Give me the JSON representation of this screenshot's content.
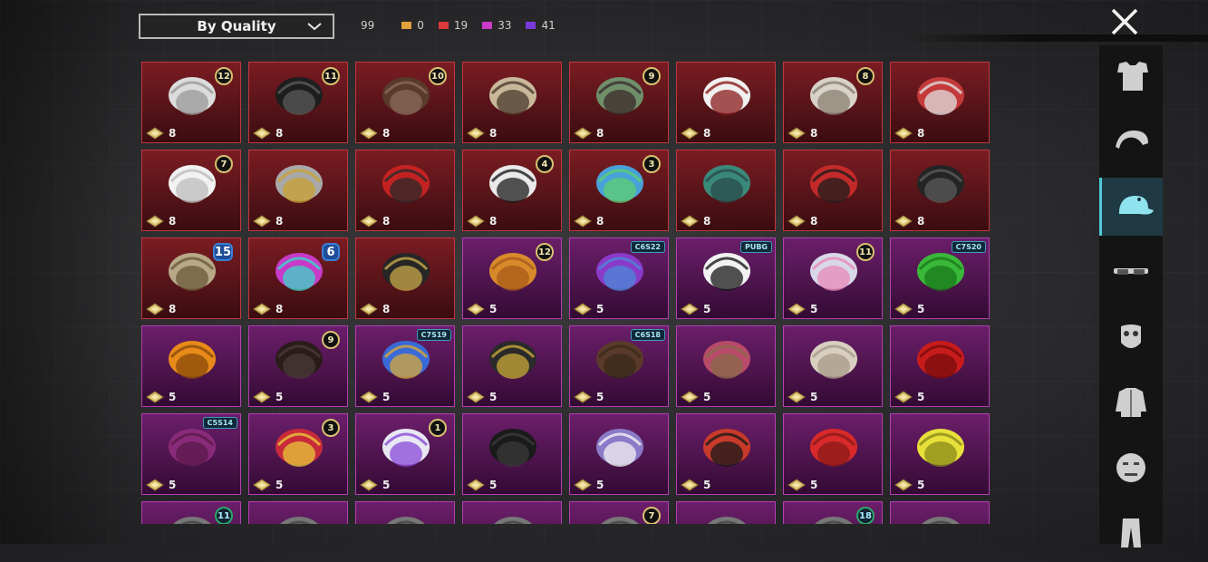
{
  "sort": {
    "label": "By Quality"
  },
  "counts": {
    "total": "99",
    "items": [
      {
        "color": "#e0a23a",
        "value": "0"
      },
      {
        "color": "#d93a3a",
        "value": "19"
      },
      {
        "color": "#c93ac8",
        "value": "33"
      },
      {
        "color": "#7a3ad9",
        "value": "41"
      }
    ]
  },
  "grid": {
    "items": [
      {
        "quality": "red",
        "badge": "12",
        "points": "8",
        "icon": "white-hair-icon"
      },
      {
        "quality": "red",
        "badge": "11",
        "points": "8",
        "icon": "black-cap-icon"
      },
      {
        "quality": "red",
        "badge": "10",
        "points": "8",
        "icon": "brown-hair-icon"
      },
      {
        "quality": "red",
        "badge": "",
        "points": "8",
        "icon": "bone-helmet-icon"
      },
      {
        "quality": "red",
        "badge": "9",
        "points": "8",
        "icon": "zombie-head-icon"
      },
      {
        "quality": "red",
        "badge": "",
        "points": "8",
        "icon": "cowboy-hat-icon"
      },
      {
        "quality": "red",
        "badge": "8",
        "points": "8",
        "icon": "silver-hair-icon"
      },
      {
        "quality": "red",
        "badge": "",
        "points": "8",
        "icon": "demon-mask-icon"
      },
      {
        "quality": "red",
        "badge": "7",
        "points": "8",
        "icon": "white-wig-icon"
      },
      {
        "quality": "red",
        "badge": "",
        "points": "8",
        "icon": "horse-mask-icon"
      },
      {
        "quality": "red",
        "badge": "",
        "points": "8",
        "icon": "red-helmet-icon"
      },
      {
        "quality": "red",
        "badge": "4",
        "points": "8",
        "icon": "snowman-hat-icon"
      },
      {
        "quality": "red",
        "badge": "3",
        "points": "8",
        "icon": "joker-mask-icon"
      },
      {
        "quality": "red",
        "badge": "",
        "points": "8",
        "icon": "teal-helmet-icon"
      },
      {
        "quality": "red",
        "badge": "",
        "points": "8",
        "icon": "oni-mask-icon"
      },
      {
        "quality": "red",
        "badge": "",
        "points": "8",
        "icon": "dark-helmet-icon"
      },
      {
        "quality": "red",
        "badge": "15",
        "badgeStyle": "big",
        "points": "8",
        "icon": "knight-helmet-icon"
      },
      {
        "quality": "red",
        "badge": "6",
        "badgeStyle": "big",
        "points": "8",
        "icon": "cyber-head-icon"
      },
      {
        "quality": "red",
        "badge": "",
        "points": "8",
        "icon": "tricorn-hat-icon"
      },
      {
        "quality": "purple",
        "badge": "12",
        "points": "5",
        "icon": "orange-hair-icon"
      },
      {
        "quality": "purple",
        "tag": "C6S22",
        "points": "5",
        "icon": "purple-hair-icon"
      },
      {
        "quality": "purple",
        "tag": "PUBG",
        "points": "5",
        "icon": "panda-mask-icon"
      },
      {
        "quality": "purple",
        "badge": "11",
        "points": "5",
        "icon": "flower-veil-icon"
      },
      {
        "quality": "purple",
        "tag": "C7S20",
        "points": "5",
        "icon": "green-pigtails-icon"
      },
      {
        "quality": "purple",
        "badge": "",
        "points": "5",
        "icon": "pumpkin-head-icon"
      },
      {
        "quality": "purple",
        "badge": "9",
        "points": "5",
        "icon": "black-hair-icon"
      },
      {
        "quality": "purple",
        "tag": "C7S19",
        "points": "5",
        "icon": "blue-dread-icon"
      },
      {
        "quality": "purple",
        "badge": "",
        "points": "5",
        "icon": "goggles-icon"
      },
      {
        "quality": "purple",
        "tag": "C6S18",
        "points": "5",
        "icon": "brown-bob-icon"
      },
      {
        "quality": "purple",
        "badge": "",
        "points": "5",
        "icon": "witch-hat-icon"
      },
      {
        "quality": "purple",
        "badge": "",
        "points": "5",
        "icon": "curly-pigtails-icon"
      },
      {
        "quality": "purple",
        "badge": "",
        "points": "5",
        "icon": "red-hair-icon"
      },
      {
        "quality": "purple",
        "tag": "C5S14",
        "points": "5",
        "icon": "magenta-hair-icon"
      },
      {
        "quality": "purple",
        "badge": "3",
        "points": "5",
        "icon": "jester-hat-icon"
      },
      {
        "quality": "purple",
        "badge": "1",
        "points": "5",
        "icon": "silver-braid-icon"
      },
      {
        "quality": "purple",
        "badge": "",
        "points": "5",
        "icon": "black-braid-icon"
      },
      {
        "quality": "purple",
        "badge": "",
        "points": "5",
        "icon": "bunny-mask-icon"
      },
      {
        "quality": "purple",
        "badge": "",
        "points": "5",
        "icon": "red-beanie-icon"
      },
      {
        "quality": "purple",
        "badge": "",
        "points": "5",
        "icon": "red-bows-icon"
      },
      {
        "quality": "purple",
        "badge": "",
        "points": "5",
        "icon": "yellow-bucket-hat-icon"
      },
      {
        "quality": "purple",
        "badge": "11",
        "badgeStyle": "green",
        "points": "",
        "icon": "partial-item-icon"
      },
      {
        "quality": "purple",
        "badge": "",
        "points": "",
        "icon": "partial-item-icon"
      },
      {
        "quality": "purple",
        "badge": "",
        "points": "",
        "icon": "partial-item-icon"
      },
      {
        "quality": "purple",
        "badge": "",
        "points": "",
        "icon": "partial-item-icon"
      },
      {
        "quality": "purple",
        "badge": "7",
        "points": "",
        "icon": "partial-item-icon"
      },
      {
        "quality": "purple",
        "badge": "",
        "points": "",
        "icon": "partial-item-icon"
      },
      {
        "quality": "purple",
        "badge": "18",
        "badgeStyle": "green",
        "points": "",
        "icon": "partial-item-icon"
      },
      {
        "quality": "purple",
        "badge": "",
        "points": "",
        "icon": "partial-item-icon"
      }
    ]
  },
  "side_tabs": [
    {
      "icon": "outfit-icon",
      "active": false
    },
    {
      "icon": "hair-icon",
      "active": false
    },
    {
      "icon": "hat-icon",
      "active": true
    },
    {
      "icon": "glasses-icon",
      "active": false
    },
    {
      "icon": "mask-icon",
      "active": false
    },
    {
      "icon": "jacket-icon",
      "active": false
    },
    {
      "icon": "face-icon",
      "active": false
    },
    {
      "icon": "pants-icon",
      "active": false
    }
  ]
}
